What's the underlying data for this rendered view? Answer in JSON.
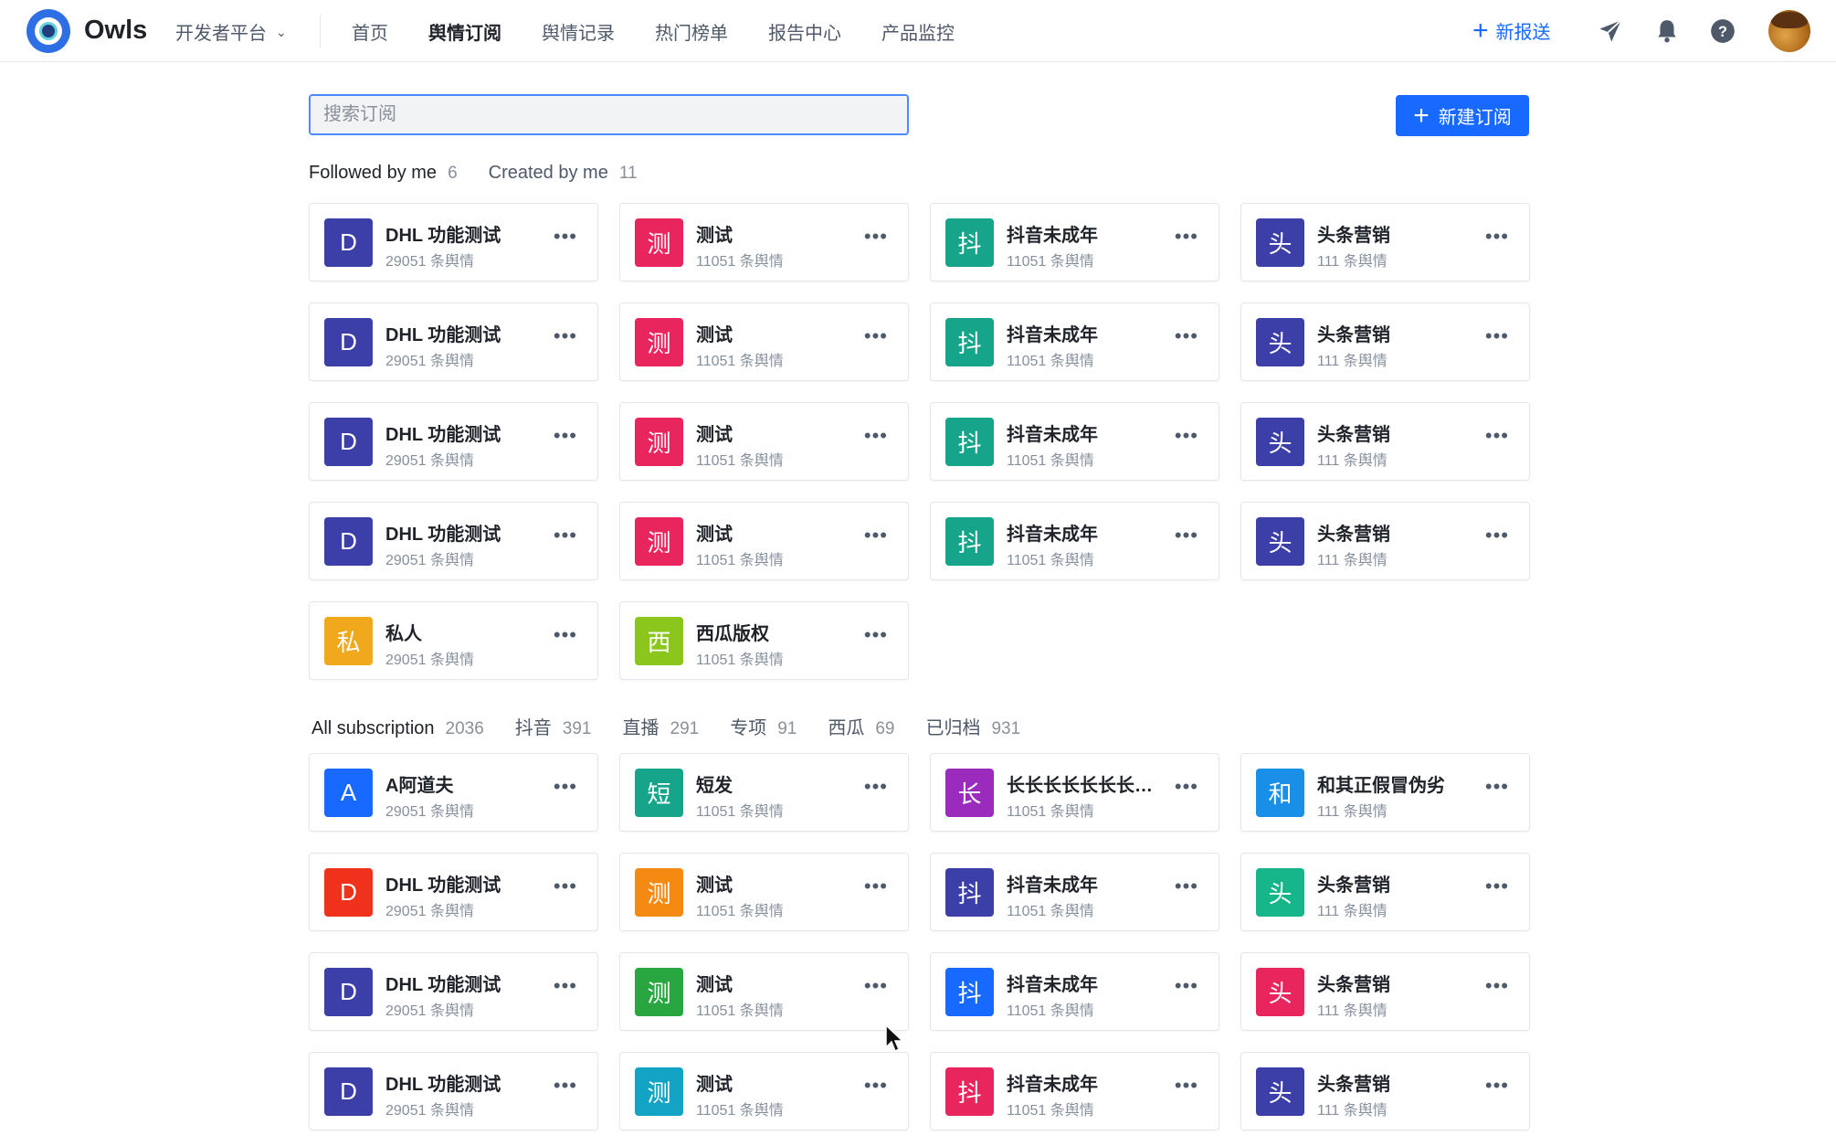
{
  "header": {
    "brand": "Owls",
    "platform": "开发者平台",
    "nav": [
      {
        "label": "首页",
        "active": false
      },
      {
        "label": "舆情订阅",
        "active": true
      },
      {
        "label": "舆情记录",
        "active": false
      },
      {
        "label": "热门榜单",
        "active": false
      },
      {
        "label": "报告中心",
        "active": false
      },
      {
        "label": "产品监控",
        "active": false
      }
    ],
    "new_push": "新报送",
    "icons": [
      "paper-plane-icon",
      "bell-icon",
      "help-icon",
      "avatar"
    ]
  },
  "toolbar": {
    "search_placeholder": "搜索订阅",
    "new_subscription": "新建订阅"
  },
  "followed_tabs": [
    {
      "label": "Followed by me",
      "count": "6",
      "active": true
    },
    {
      "label": "Created by me",
      "count": "11",
      "active": false
    }
  ],
  "followed_cards": [
    {
      "icon": "D",
      "color": "#3c3fa8",
      "name": "DHL 功能测试",
      "count": "29051 条舆情"
    },
    {
      "icon": "测",
      "color": "#e8265d",
      "name": "测试",
      "count": "11051 条舆情"
    },
    {
      "icon": "抖",
      "color": "#16a58a",
      "name": "抖音未成年",
      "count": "11051 条舆情"
    },
    {
      "icon": "头",
      "color": "#3c3fa8",
      "name": "头条营销",
      "count": "111 条舆情"
    },
    {
      "icon": "D",
      "color": "#3c3fa8",
      "name": "DHL 功能测试",
      "count": "29051 条舆情"
    },
    {
      "icon": "测",
      "color": "#e8265d",
      "name": "测试",
      "count": "11051 条舆情"
    },
    {
      "icon": "抖",
      "color": "#16a58a",
      "name": "抖音未成年",
      "count": "11051 条舆情"
    },
    {
      "icon": "头",
      "color": "#3c3fa8",
      "name": "头条营销",
      "count": "111 条舆情"
    },
    {
      "icon": "D",
      "color": "#3c3fa8",
      "name": "DHL 功能测试",
      "count": "29051 条舆情"
    },
    {
      "icon": "测",
      "color": "#e8265d",
      "name": "测试",
      "count": "11051 条舆情"
    },
    {
      "icon": "抖",
      "color": "#16a58a",
      "name": "抖音未成年",
      "count": "11051 条舆情"
    },
    {
      "icon": "头",
      "color": "#3c3fa8",
      "name": "头条营销",
      "count": "111 条舆情"
    },
    {
      "icon": "D",
      "color": "#3c3fa8",
      "name": "DHL 功能测试",
      "count": "29051 条舆情"
    },
    {
      "icon": "测",
      "color": "#e8265d",
      "name": "测试",
      "count": "11051 条舆情"
    },
    {
      "icon": "抖",
      "color": "#16a58a",
      "name": "抖音未成年",
      "count": "11051 条舆情"
    },
    {
      "icon": "头",
      "color": "#3c3fa8",
      "name": "头条营销",
      "count": "111 条舆情"
    },
    {
      "icon": "私",
      "color": "#f0a81c",
      "name": "私人",
      "count": "29051 条舆情"
    },
    {
      "icon": "西",
      "color": "#8bc61c",
      "name": "西瓜版权",
      "count": "11051 条舆情"
    }
  ],
  "all_tabs": [
    {
      "label": "All subscription",
      "count": "2036",
      "active": true
    },
    {
      "label": "抖音",
      "count": "391",
      "active": false
    },
    {
      "label": "直播",
      "count": "291",
      "active": false
    },
    {
      "label": "专项",
      "count": "91",
      "active": false
    },
    {
      "label": "西瓜",
      "count": "69",
      "active": false
    },
    {
      "label": "已归档",
      "count": "931",
      "active": false
    }
  ],
  "all_cards": [
    {
      "icon": "A",
      "color": "#1769ff",
      "name": "A阿道夫",
      "count": "29051 条舆情"
    },
    {
      "icon": "短",
      "color": "#16a58a",
      "name": "短发",
      "count": "11051 条舆情"
    },
    {
      "icon": "长",
      "color": "#9b2bbd",
      "name": "长长长长长长长长长长长长",
      "count": "11051 条舆情"
    },
    {
      "icon": "和",
      "color": "#1a8fe8",
      "name": "和其正假冒伪劣",
      "count": "111 条舆情"
    },
    {
      "icon": "D",
      "color": "#f0321c",
      "name": "DHL 功能测试",
      "count": "29051 条舆情"
    },
    {
      "icon": "测",
      "color": "#f58a12",
      "name": "测试",
      "count": "11051 条舆情"
    },
    {
      "icon": "抖",
      "color": "#3c3fa8",
      "name": "抖音未成年",
      "count": "11051 条舆情"
    },
    {
      "icon": "头",
      "color": "#16b58a",
      "name": "头条营销",
      "count": "111 条舆情"
    },
    {
      "icon": "D",
      "color": "#3c3fa8",
      "name": "DHL 功能测试",
      "count": "29051 条舆情"
    },
    {
      "icon": "测",
      "color": "#2aa640",
      "name": "测试",
      "count": "11051 条舆情"
    },
    {
      "icon": "抖",
      "color": "#1769ff",
      "name": "抖音未成年",
      "count": "11051 条舆情"
    },
    {
      "icon": "头",
      "color": "#e8265d",
      "name": "头条营销",
      "count": "111 条舆情"
    },
    {
      "icon": "D",
      "color": "#3c3fa8",
      "name": "DHL 功能测试",
      "count": "29051 条舆情"
    },
    {
      "icon": "测",
      "color": "#13a3c4",
      "name": "测试",
      "count": "11051 条舆情"
    },
    {
      "icon": "抖",
      "color": "#e8265d",
      "name": "抖音未成年",
      "count": "11051 条舆情"
    },
    {
      "icon": "头",
      "color": "#3c3fa8",
      "name": "头条营销",
      "count": "111 条舆情"
    }
  ]
}
